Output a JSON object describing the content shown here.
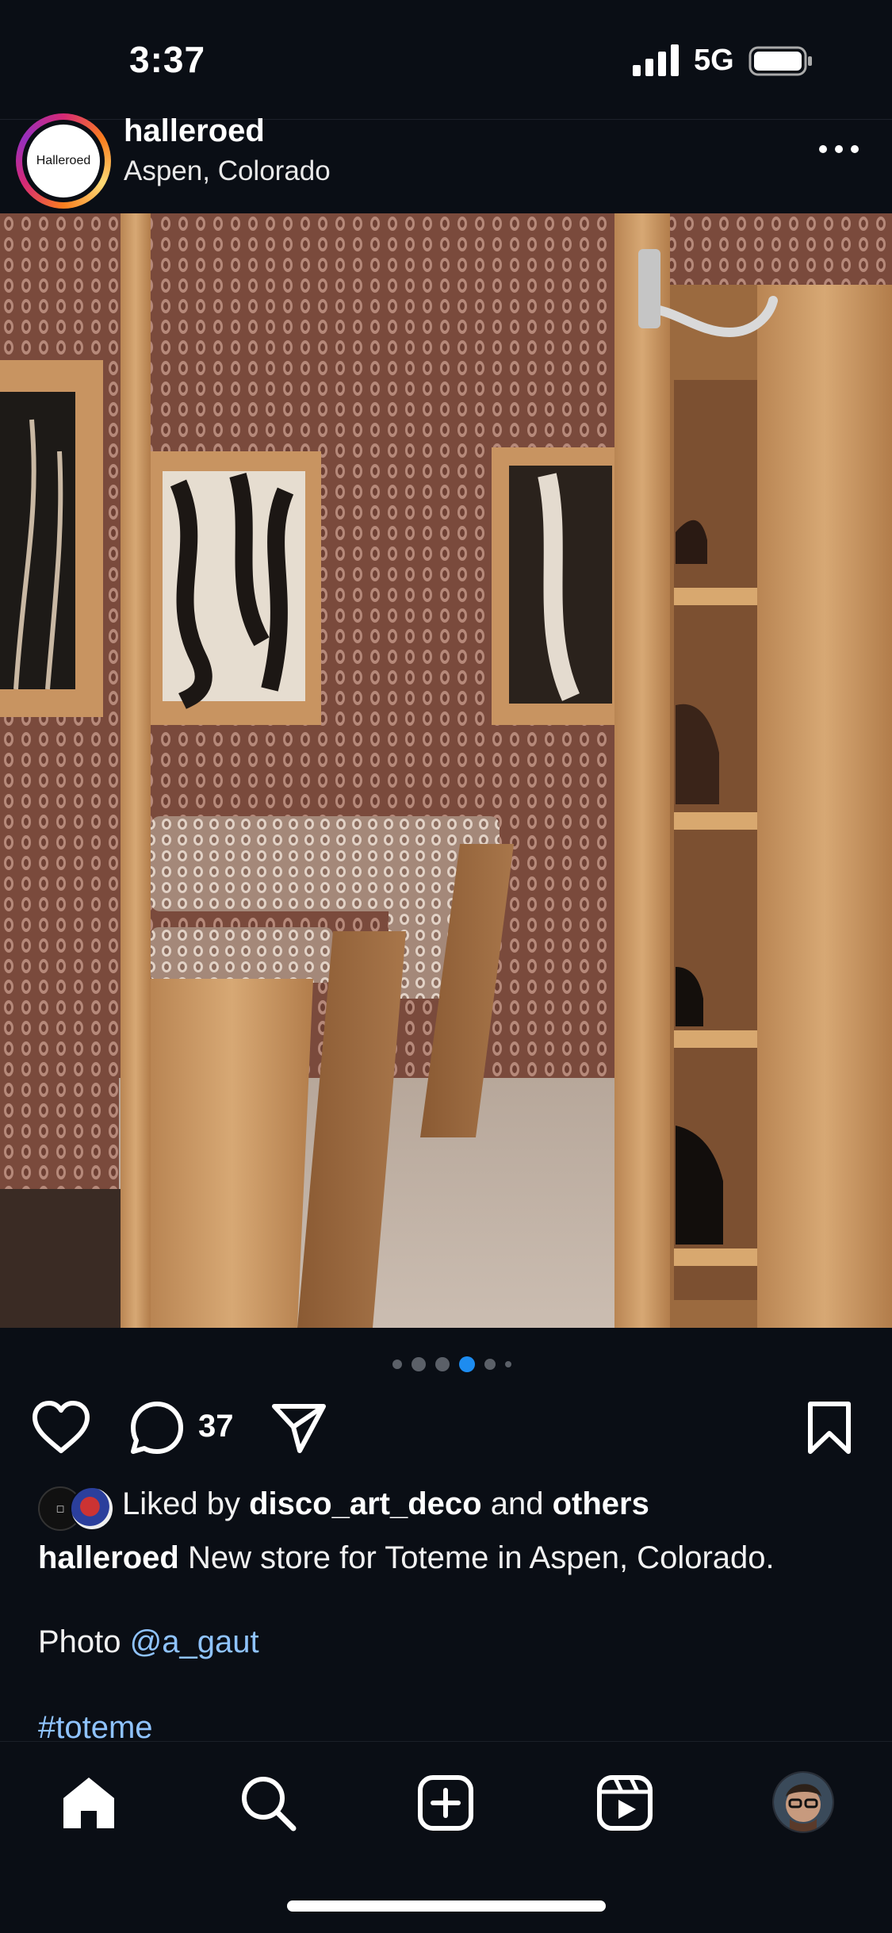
{
  "status_bar": {
    "time": "3:37",
    "network": "5G"
  },
  "post": {
    "avatar_text": "Halleroed",
    "username": "halleroed",
    "location": "Aspen, Colorado",
    "carousel": {
      "total": 6,
      "active_index": 3
    },
    "comment_count": "37",
    "likes": {
      "prefix": "Liked by",
      "first_user": "disco_art_deco",
      "and": "and",
      "others": "others"
    },
    "caption": {
      "user": "halleroed",
      "text": "New store for Toteme in Aspen, Colorado."
    },
    "photo_credit": {
      "label": "Photo",
      "handle": "@a_gaut"
    },
    "hashtag": "#toteme"
  },
  "icons": {
    "more": "more-horizontal-icon",
    "like": "heart-icon",
    "comment": "comment-icon",
    "share": "share-icon",
    "save": "bookmark-icon",
    "home": "home-icon",
    "search": "search-icon",
    "create": "plus-square-icon",
    "reels": "reels-icon",
    "profile": "profile-avatar"
  },
  "colors": {
    "background": "#0a0e15",
    "link": "#8fc3ff",
    "active_dot": "#1d8cf0"
  }
}
